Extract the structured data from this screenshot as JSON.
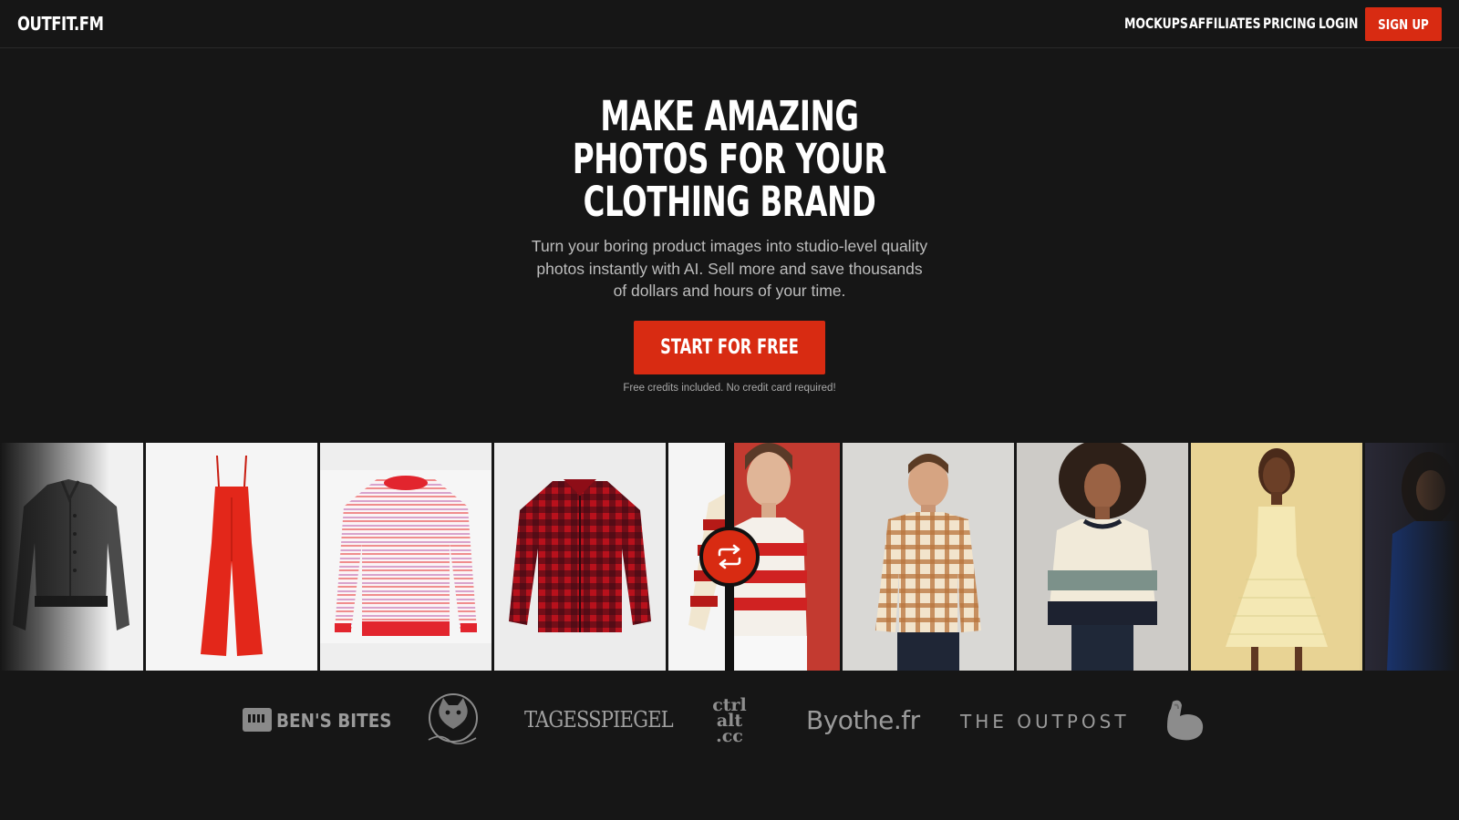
{
  "header": {
    "logo": "OUTFIT.FM",
    "nav": [
      {
        "label": "MOCKUPS"
      },
      {
        "label": "AFFILIATES"
      },
      {
        "label": "PRICING"
      },
      {
        "label": "LOGIN"
      }
    ],
    "signup_label": "SIGN UP"
  },
  "hero": {
    "title_lines": [
      "MAKE AMAZING",
      "PHOTOS FOR YOUR",
      "CLOTHING BRAND"
    ],
    "subtitle": "Turn your boring product images into studio-level quality photos instantly with AI. Sell more and save thousands of dollars and hours of your time.",
    "cta_label": "START FOR FREE",
    "cta_note": "Free credits included. No credit card required!"
  },
  "gallery": {
    "product_tiles": [
      "grey-jacket-photo",
      "red-jumpsuit-photo",
      "striped-sweater-photo",
      "plaid-shirt-photo",
      "striped-jersey-photo"
    ],
    "model_tiles": [
      "model-red-stripe-photo",
      "model-plaid-shirt-photo",
      "model-striped-sweater-photo",
      "model-yellow-dress-photo",
      "model-blue-jacket-photo"
    ],
    "swap_icon": "swap-icon",
    "accent": "#d82b12"
  },
  "press_logos": {
    "bens_bites": "BEN'S BITES",
    "tagesspiegel": "TAGESSPIEGEL",
    "ctrlalt": [
      "ctrl",
      "alt",
      ".cc"
    ],
    "byothe": "Byothe.fr",
    "outpost": "THE OUTPOST",
    "icons": [
      "product-hunt-cat-logo",
      "flexed-arm-logo"
    ]
  }
}
